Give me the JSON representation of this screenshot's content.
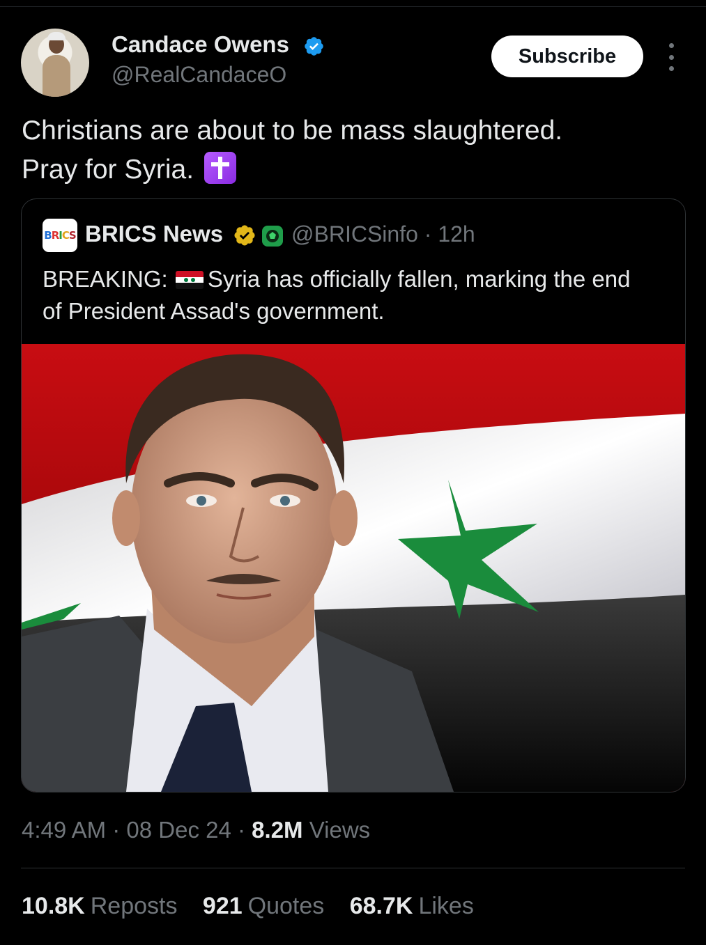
{
  "author": {
    "name": "Candace Owens",
    "handle": "@RealCandaceO",
    "verified_color": "#1d9bf0"
  },
  "header": {
    "subscribe_label": "Subscribe",
    "more_icon": "more-vertical-icon"
  },
  "tweet": {
    "text_line1": "Christians are about to be mass slaughtered.",
    "text_line2": "Pray for Syria.",
    "emoji": "latin-cross-emoji"
  },
  "quote": {
    "logo_text": "BRICS",
    "name": "BRICS News",
    "handle_time": "@BRICSinfo · 12h",
    "text_prefix": "BREAKING:",
    "text_body": "Syria has officially fallen, marking the end of President Assad's government.",
    "flag": "syria-flag-emoji",
    "image": "portrait-with-syrian-flag"
  },
  "meta": {
    "time": "4:49 AM",
    "sep1": " · ",
    "date": "08 Dec 24",
    "sep2": " · ",
    "views_count": "8.2M",
    "views_label": " Views"
  },
  "stats": {
    "reposts_count": "10.8K",
    "reposts_label": "Reposts",
    "quotes_count": "921",
    "quotes_label": "Quotes",
    "likes_count": "68.7K",
    "likes_label": "Likes"
  },
  "colors": {
    "background": "#000000",
    "text": "#e7e9ea",
    "muted": "#71767b",
    "border": "#2f3336",
    "flag_red": "#ce1126",
    "flag_green": "#007a3d"
  }
}
